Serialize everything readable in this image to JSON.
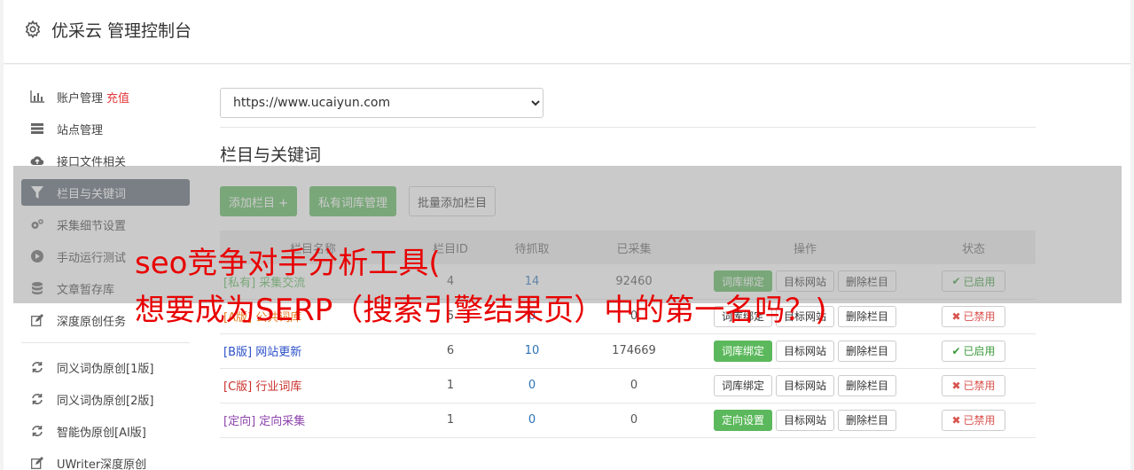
{
  "header": {
    "title": "优采云 管理控制台",
    "icon": "gear-icon"
  },
  "sidebar": {
    "items": [
      {
        "label": "账户管理",
        "extra": "充值",
        "icon": "bar-chart-icon"
      },
      {
        "label": "站点管理",
        "icon": "server-icon"
      },
      {
        "label": "接口文件相关",
        "icon": "cloud-upload-icon"
      },
      {
        "label": "栏目与关键词",
        "icon": "filter-icon",
        "active": true
      },
      {
        "label": "采集细节设置",
        "icon": "gears-icon"
      },
      {
        "label": "手动运行测试",
        "icon": "play-circle-icon"
      },
      {
        "label": "文章暂存库",
        "icon": "database-icon"
      },
      {
        "label": "深度原创任务",
        "icon": "edit-icon"
      },
      {
        "label": "同义词伪原创[1版]",
        "icon": "refresh-icon"
      },
      {
        "label": "同义词伪原创[2版]",
        "icon": "refresh-icon"
      },
      {
        "label": "智能伪原创[AI版]",
        "icon": "refresh-icon"
      },
      {
        "label": "UWriter深度原创",
        "icon": "edit-icon"
      }
    ],
    "recharge_color": "#e4393c"
  },
  "main": {
    "site_select": {
      "value": "https://www.ucaiyun.com"
    },
    "section_title": "栏目与关键词",
    "buttons": {
      "add_column": "添加栏目 +",
      "private_lib": "私有词库管理",
      "batch_add": "批量添加栏目"
    },
    "table": {
      "headers": [
        "栏目名称",
        "栏目ID",
        "待抓取",
        "已采集",
        "操作",
        "状态"
      ],
      "rows": [
        {
          "tag": "[私有]",
          "name": "采集交流",
          "id": "4",
          "pending": "14",
          "collected": "92460",
          "op1": "词库绑定",
          "op1_green": true,
          "op2": "目标网站",
          "op3": "删除栏目",
          "status": "已启用",
          "on": true,
          "tag_class": "tag-private"
        },
        {
          "tag": "[A版]",
          "name": "公共词库",
          "id": "5",
          "pending": "0",
          "collected": "0",
          "op1": "词库绑定",
          "op1_green": false,
          "op2": "目标网站",
          "op3": "删除栏目",
          "status": "已禁用",
          "on": false,
          "tag_class": "tag-a"
        },
        {
          "tag": "[B版]",
          "name": "网站更新",
          "id": "6",
          "pending": "10",
          "collected": "174669",
          "op1": "词库绑定",
          "op1_green": true,
          "op2": "目标网站",
          "op3": "删除栏目",
          "status": "已启用",
          "on": true,
          "tag_class": "tag-b"
        },
        {
          "tag": "[C版]",
          "name": "行业词库",
          "id": "1",
          "pending": "0",
          "collected": "0",
          "op1": "词库绑定",
          "op1_green": false,
          "op2": "目标网站",
          "op3": "删除栏目",
          "status": "已禁用",
          "on": false,
          "tag_class": "tag-c"
        },
        {
          "tag": "[定向]",
          "name": "定向采集",
          "id": "1",
          "pending": "0",
          "collected": "0",
          "op1": "定向设置",
          "op1_green": true,
          "op2": "目标网站",
          "op3": "删除栏目",
          "status": "已禁用",
          "on": false,
          "tag_class": "tag-d"
        }
      ]
    }
  },
  "overlay": {
    "line1": "seo竞争对手分析工具(",
    "line2": "想要成为SERP（搜索引擎结果页）中的第一名吗？)",
    "text_color": "#e80000"
  },
  "colors": {
    "accent_green": "#5cb85c",
    "active_nav": "#5d6874",
    "link_blue": "#2b72b8"
  }
}
